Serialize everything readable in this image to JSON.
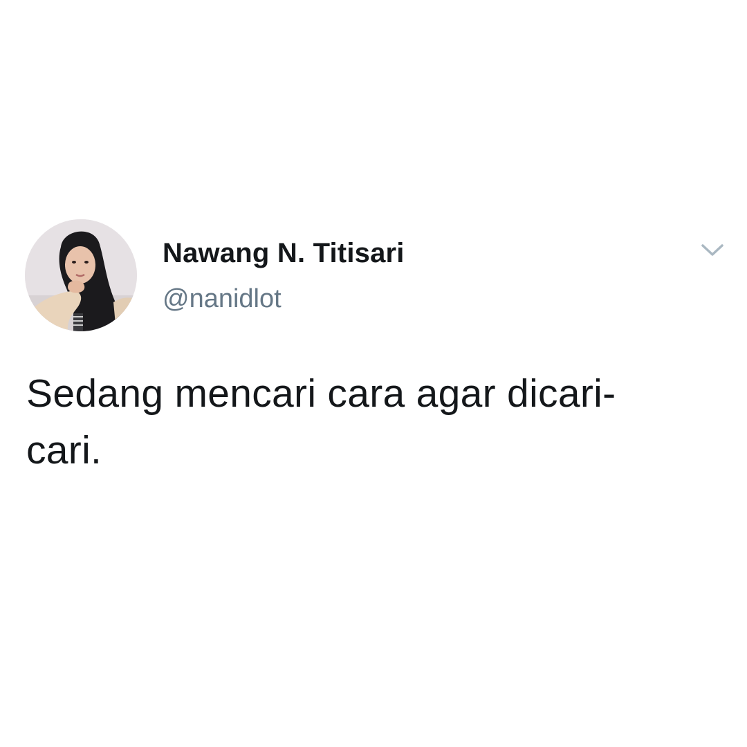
{
  "tweet": {
    "author": {
      "display_name": "Nawang N. Titisari",
      "handle": "@nanidlot",
      "avatar_icon": "profile-photo"
    },
    "menu_icon": "chevron-down-icon",
    "text_lines": [
      "Sedang mencari cara agar dicari-",
      "cari."
    ]
  },
  "colors": {
    "background": "#ffffff",
    "name_text": "#14171a",
    "handle_text": "#657786",
    "chevron": "#aab8c2",
    "body_text": "#14171a"
  }
}
